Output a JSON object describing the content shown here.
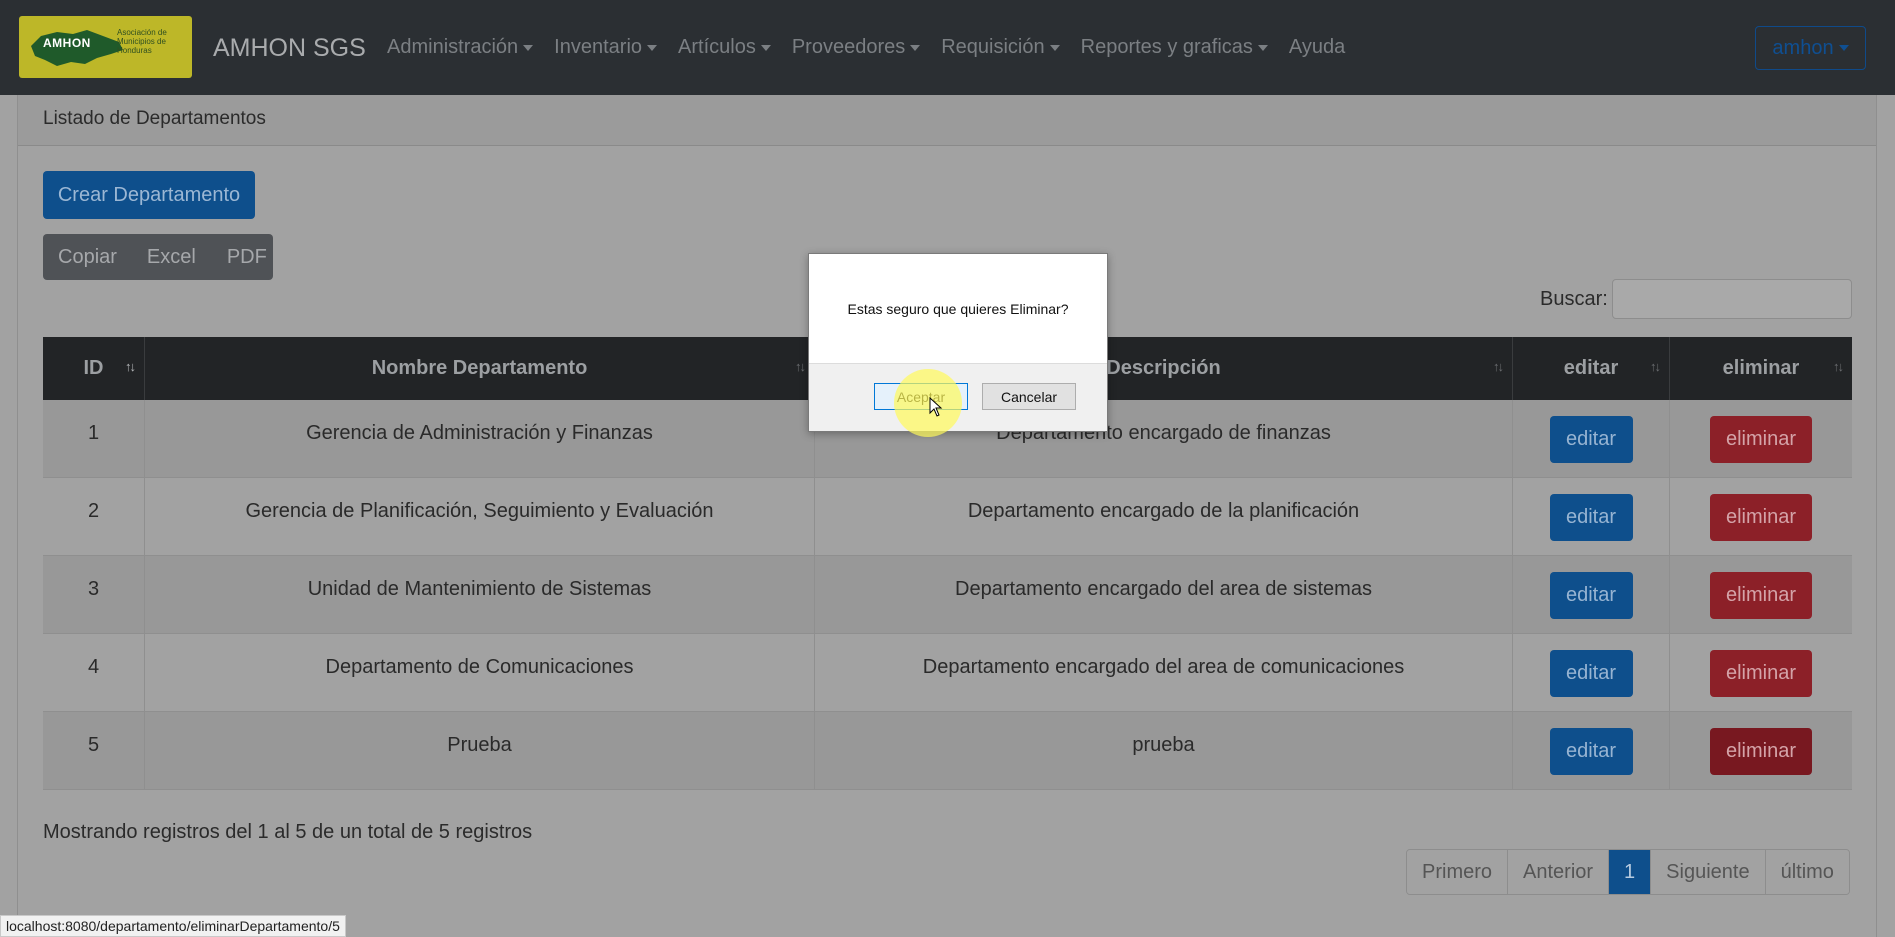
{
  "navbar": {
    "logo": {
      "text": "AMHON",
      "sub": "Asociación de Municipios de Honduras"
    },
    "brand": "AMHON SGS",
    "items": [
      {
        "label": "Administración",
        "dropdown": true
      },
      {
        "label": "Inventario",
        "dropdown": true
      },
      {
        "label": "Artículos",
        "dropdown": true
      },
      {
        "label": "Proveedores",
        "dropdown": true
      },
      {
        "label": "Requisición",
        "dropdown": true
      },
      {
        "label": "Reportes y graficas",
        "dropdown": true
      },
      {
        "label": "Ayuda",
        "dropdown": false
      }
    ],
    "user": "amhon"
  },
  "card": {
    "title": "Listado de Departamentos"
  },
  "toolbar": {
    "create_label": "Crear Departamento",
    "export": {
      "copy": "Copiar",
      "excel": "Excel",
      "pdf": "PDF"
    },
    "search_label": "Buscar:",
    "search_value": ""
  },
  "table": {
    "headers": {
      "id": "ID",
      "name": "Nombre Departamento",
      "desc": "Descripción",
      "edit": "editar",
      "delete": "eliminar"
    },
    "rows": [
      {
        "id": "1",
        "name": "Gerencia de Administración y Finanzas",
        "desc": "Departamento encargado de finanzas",
        "edit": "editar",
        "delete": "eliminar"
      },
      {
        "id": "2",
        "name": "Gerencia de Planificación, Seguimiento y Evaluación",
        "desc": "Departamento encargado de la planificación",
        "edit": "editar",
        "delete": "eliminar"
      },
      {
        "id": "3",
        "name": "Unidad de Mantenimiento de Sistemas",
        "desc": "Departamento encargado del area de sistemas",
        "edit": "editar",
        "delete": "eliminar"
      },
      {
        "id": "4",
        "name": "Departamento de Comunicaciones",
        "desc": "Departamento encargado del area de comunicaciones",
        "edit": "editar",
        "delete": "eliminar"
      },
      {
        "id": "5",
        "name": "Prueba",
        "desc": "prueba",
        "edit": "editar",
        "delete": "eliminar"
      }
    ]
  },
  "footer": {
    "info": "Mostrando registros del 1 al 5 de un total de 5 registros",
    "pagination": {
      "first": "Primero",
      "prev": "Anterior",
      "current": "1",
      "next": "Siguiente",
      "last": "último"
    }
  },
  "status_url": "localhost:8080/departamento/eliminarDepartamento/5",
  "dialog": {
    "message": "Estas seguro que quieres Eliminar?",
    "ok": "Aceptar",
    "cancel": "Cancelar"
  },
  "colors": {
    "navbar": "#2b2f33",
    "primary": "#0e4f8c",
    "danger": "#8c2028",
    "overlay": "#a2a2a2"
  }
}
